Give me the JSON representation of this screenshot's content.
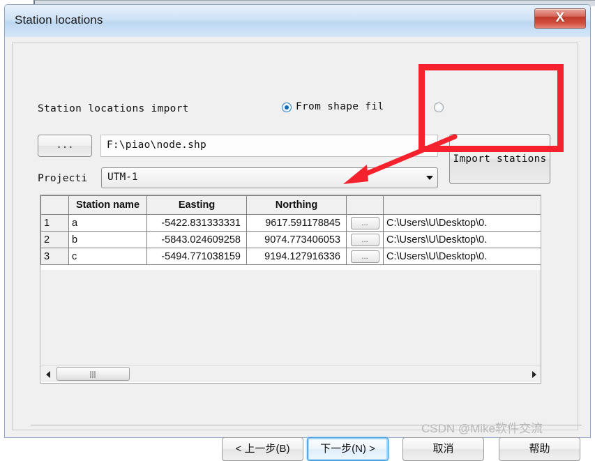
{
  "window": {
    "title": "Station locations",
    "close_label": "X"
  },
  "form": {
    "import_label": "Station locations import",
    "options": [
      {
        "label": "From shape fil",
        "selected": true
      },
      {
        "label": "",
        "selected": false
      }
    ],
    "browse_button": "...",
    "file_path": "F:\\piao\\node.shp",
    "projection_label": "Projecti",
    "projection_value": "UTM-1",
    "import_stations_button": "Import stations"
  },
  "table": {
    "columns": [
      "",
      "Station name",
      "Easting",
      "Northing",
      "",
      ""
    ],
    "rows": [
      {
        "num": "1",
        "name": "a",
        "easting": "-5422.831333331",
        "northing": "9617.591178845",
        "browse": "...",
        "path": "C:\\Users\\U\\Desktop\\0."
      },
      {
        "num": "2",
        "name": "b",
        "easting": "-5843.024609258",
        "northing": "9074.773406053",
        "browse": "...",
        "path": "C:\\Users\\U\\Desktop\\0."
      },
      {
        "num": "3",
        "name": "c",
        "easting": "-5494.771038159",
        "northing": "9194.127916336",
        "browse": "...",
        "path": "C:\\Users\\U\\Desktop\\0."
      }
    ]
  },
  "footer": {
    "back": "< 上一步(B)",
    "next": "下一步(N) >",
    "cancel": "取消",
    "help": "帮助"
  },
  "watermark": "CSDN @Mike软件交流",
  "colors": {
    "annotation": "#f5222d",
    "titlebar": "#bdd7f2",
    "dialog_bg": "#f0f0f0"
  }
}
